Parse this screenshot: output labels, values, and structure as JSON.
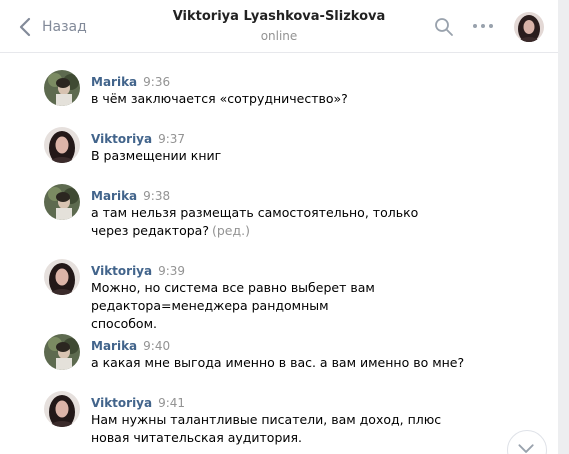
{
  "header": {
    "back_label": "Назад",
    "title": "Viktoriya Lyashkova-Slizkova",
    "status": "online"
  },
  "colors": {
    "author": "#42648b",
    "muted": "#939393",
    "icon": "#828a99"
  },
  "messages": [
    {
      "author": "Marika",
      "time": "9:36",
      "text": "в чём заключается «сотрудничество»?",
      "edited": ""
    },
    {
      "author": "Viktoriya",
      "time": "9:37",
      "text": "В размещении книг",
      "edited": ""
    },
    {
      "author": "Marika",
      "time": "9:38",
      "text": "а там нельзя размещать самостоятельно, только через редактора?",
      "edited": "(ред.)"
    },
    {
      "author": "Viktoriya",
      "time": "9:39",
      "text": "Можно, но система все равно выберет вам редактора=менеджера рандомным способом.",
      "edited": ""
    },
    {
      "author": "Marika",
      "time": "9:40",
      "text": "а какая мне выгода именно в вас. а вам именно во мне?",
      "edited": ""
    },
    {
      "author": "Viktoriya",
      "time": "9:41",
      "text": "Нам нужны талантливые писатели, вам доход, плюс новая читательская аудитория.",
      "edited": ""
    }
  ],
  "icons": {
    "back": "chevron-left-icon",
    "search": "search-icon",
    "more": "more-horizontal-icon",
    "scroll": "chevron-down-icon"
  }
}
